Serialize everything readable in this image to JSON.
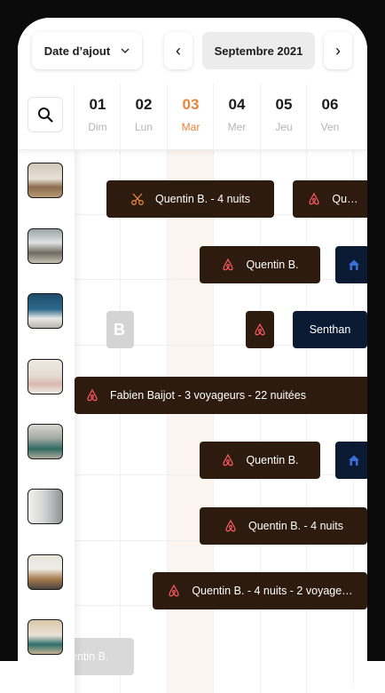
{
  "toolbar": {
    "sort_label": "Date d’ajout",
    "prev": "‹",
    "next": "›",
    "month": "Septembre 2021"
  },
  "days": [
    {
      "num": "01",
      "wd": "Dim"
    },
    {
      "num": "02",
      "wd": "Lun"
    },
    {
      "num": "03",
      "wd": "Mar"
    },
    {
      "num": "04",
      "wd": "Mer"
    },
    {
      "num": "05",
      "wd": "Jeu"
    },
    {
      "num": "06",
      "wd": "Ven"
    }
  ],
  "colors": {
    "booking": "#2e1b10",
    "booking_blue": "#0b1a33",
    "today": "#e9833a",
    "accent_red": "#ff5a5f"
  },
  "bookings": {
    "r1a": "Quentin B. - 4 nuits",
    "r1b": "Qu…",
    "r2a": "Quentin B.",
    "r3a": "B.",
    "r3c": "Senthan",
    "r4a": "Fabien Baijot - 3 voyageurs - 22 nuitées",
    "r5a": "Quentin B.",
    "r6a": "Quentin B. - 4 nuits",
    "r7a": "Quentin B. - 4 nuits - 2 voyage…",
    "r8a": "entin B."
  }
}
